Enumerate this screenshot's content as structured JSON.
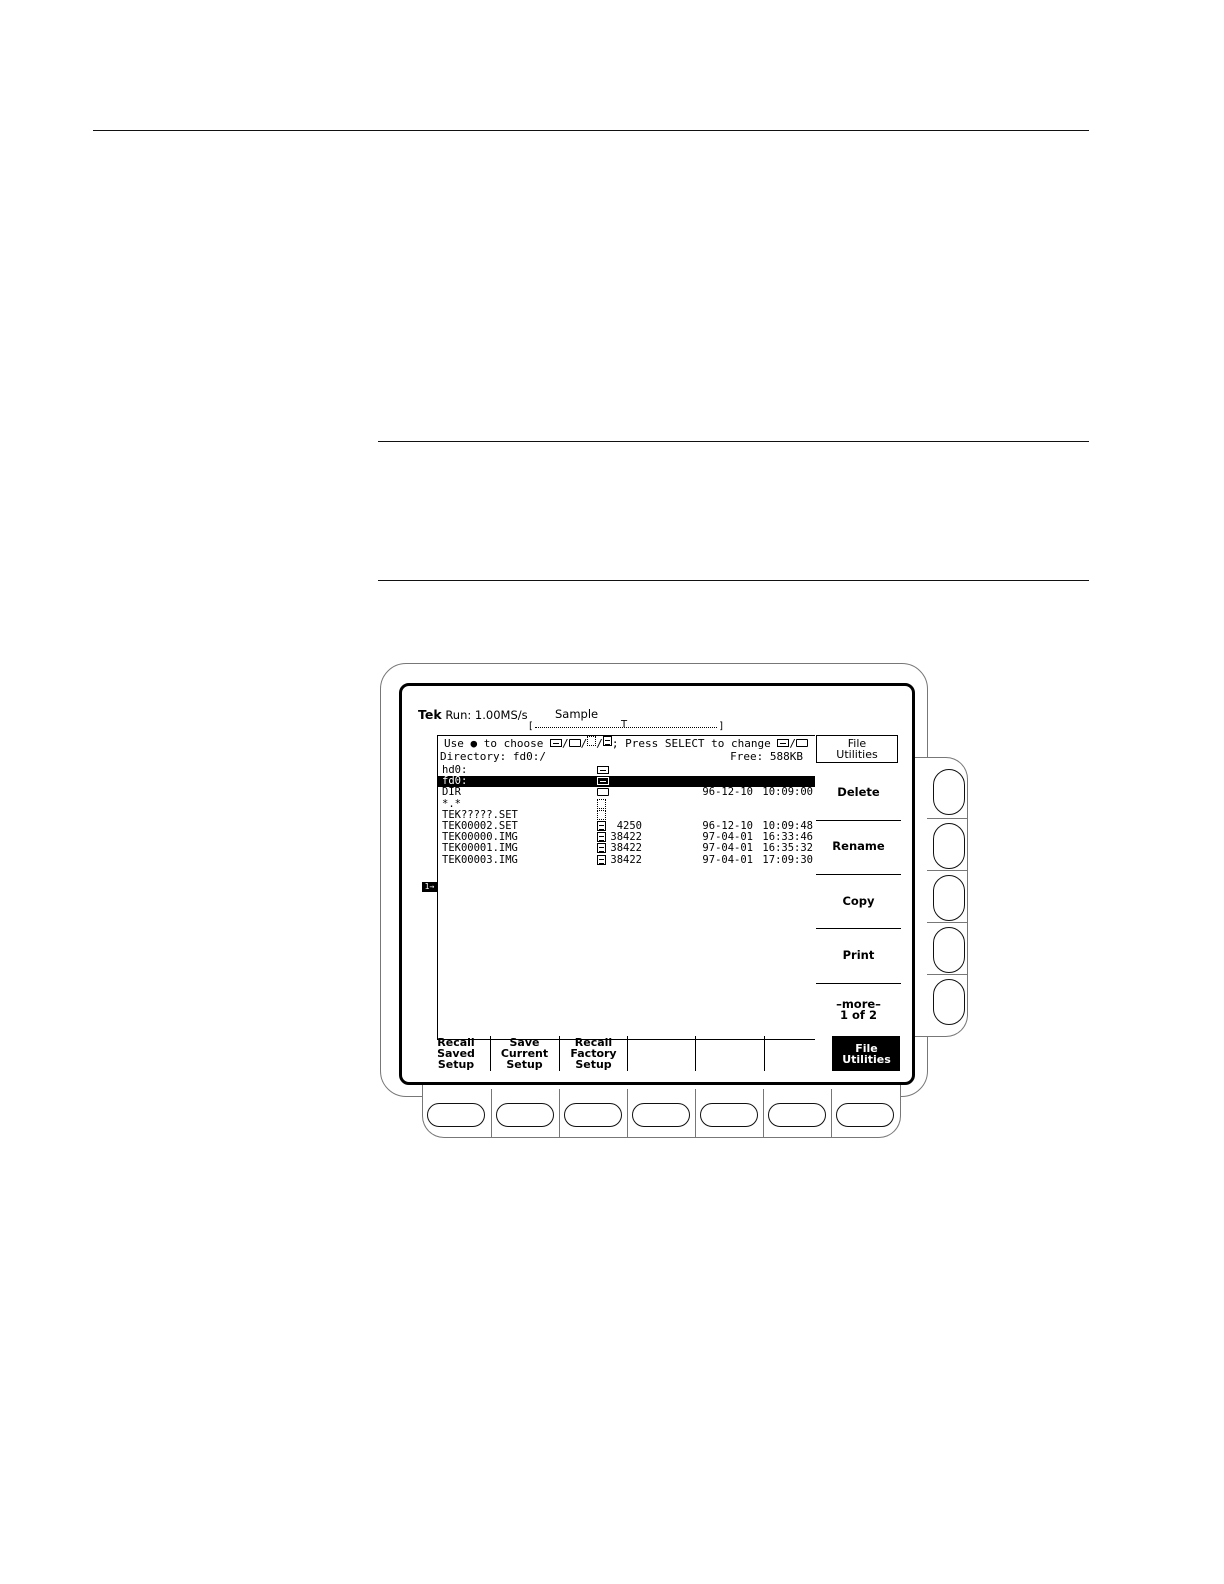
{
  "status": {
    "brand": "Tek",
    "run_label": "Run:",
    "rate": "1.00MS/s",
    "mode": "Sample",
    "trigger_marker": "T"
  },
  "file_browser": {
    "hint_prefix": "Use ● to choose ",
    "hint_mid": "; Press SELECT to change ",
    "directory": "Directory: fd0:/",
    "free": "Free: 588KB",
    "rows": [
      {
        "name": "hd0:",
        "icon": "drive-icon",
        "size": "",
        "date": "",
        "time": "",
        "selected": false
      },
      {
        "name": "fd0:",
        "icon": "drive-icon",
        "size": "",
        "date": "",
        "time": "",
        "selected": true
      },
      {
        "name": "DIR",
        "icon": "folder-icon",
        "size": "",
        "date": "96-12-10",
        "time": "10:09:00",
        "selected": false
      },
      {
        "name": "*.*",
        "icon": "file-icon",
        "size": "",
        "date": "",
        "time": "",
        "selected": false
      },
      {
        "name": "TEK?????.SET",
        "icon": "file-icon",
        "size": "",
        "date": "",
        "time": "",
        "selected": false
      },
      {
        "name": "TEK00002.SET",
        "icon": "document-icon",
        "size": "4250",
        "date": "96-12-10",
        "time": "10:09:48",
        "selected": false
      },
      {
        "name": "TEK00000.IMG",
        "icon": "document-icon",
        "size": "38422",
        "date": "97-04-01",
        "time": "16:33:46",
        "selected": false
      },
      {
        "name": "TEK00001.IMG",
        "icon": "document-icon",
        "size": "38422",
        "date": "97-04-01",
        "time": "16:35:32",
        "selected": false
      },
      {
        "name": "TEK00003.IMG",
        "icon": "document-icon",
        "size": "38422",
        "date": "97-04-01",
        "time": "17:09:30",
        "selected": false
      }
    ]
  },
  "channel_marker": "1→",
  "side_menu": {
    "title_line1": "File",
    "title_line2": "Utilities",
    "items": [
      {
        "label1": "Delete",
        "label2": ""
      },
      {
        "label1": "Rename",
        "label2": ""
      },
      {
        "label1": "Copy",
        "label2": ""
      },
      {
        "label1": "Print",
        "label2": ""
      },
      {
        "label1": "–more–",
        "label2": "1 of 2"
      }
    ]
  },
  "bottom_menu": [
    {
      "l1": "Recall",
      "l2": "Saved",
      "l3": "Setup"
    },
    {
      "l1": "Save",
      "l2": "Current",
      "l3": "Setup"
    },
    {
      "l1": "Recall",
      "l2": "Factory",
      "l3": "Setup"
    },
    {
      "l1": "",
      "l2": "",
      "l3": ""
    },
    {
      "l1": "",
      "l2": "",
      "l3": ""
    },
    {
      "l1": "",
      "l2": "",
      "l3": ""
    },
    {
      "l1": "File",
      "l2": "Utilities",
      "l3": ""
    }
  ]
}
